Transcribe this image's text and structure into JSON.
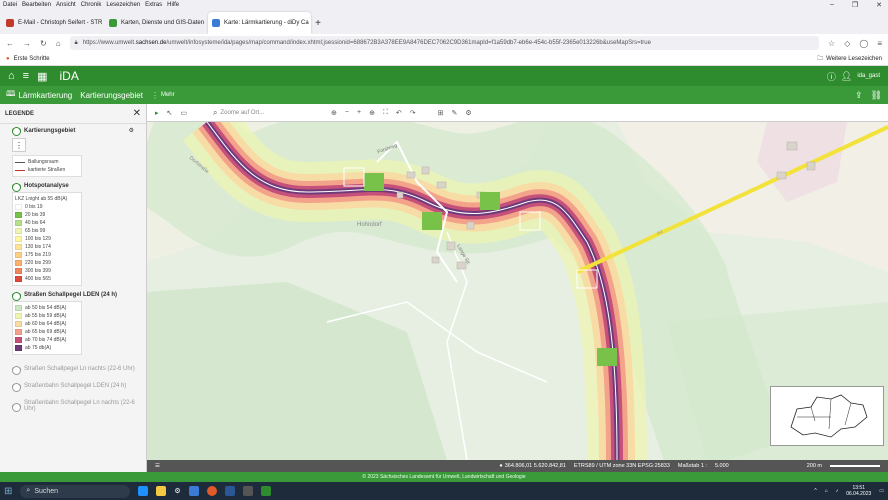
{
  "menu": [
    "Datei",
    "Bearbeiten",
    "Ansicht",
    "Chronik",
    "Lesezeichen",
    "Extras",
    "Hilfe"
  ],
  "window_controls": [
    "–",
    "❐",
    "✕"
  ],
  "tabs": [
    {
      "label": "E-Mail - Christoph Seifert - STR",
      "color": "#c0392b",
      "active": false
    },
    {
      "label": "Karten, Dienste und GIS-Daten",
      "color": "#3a9a3a",
      "active": false
    },
    {
      "label": "Karte: Lärmkartierung - diDy Ca",
      "color": "#3a7bd5",
      "active": true
    }
  ],
  "newtab": "+",
  "url": {
    "prefix": "https://www.umwelt.",
    "domain": "sachsen.de",
    "suffix": "/umwelt/infosysteme/ida/pages/map/command/index.xhtml;jsessionid=688672B3A378EE9A8476DEC7062C9D361mapId=f1a59db7-eb6e-454c-b55f-2365e013226b&useMapSrs=true"
  },
  "bookmarks": {
    "left": "Erste Schritte",
    "right": "Weitere Lesezeichen"
  },
  "app": {
    "brand": "iDA",
    "user": "ida_gast"
  },
  "themes": {
    "t1": "Lärmkartierung",
    "t2": "Kartierungsgebiet",
    "more": "Mehr"
  },
  "legend": {
    "title": "LEGENDE",
    "close": "✕",
    "groups": {
      "kartierungsgebiet": {
        "label": "Kartierungsgebiet",
        "items": [
          {
            "label": "Ballungsraum",
            "color": "#555555"
          },
          {
            "label": "kartierte Straßen",
            "color": "#c0392b"
          }
        ]
      },
      "hotspot": {
        "label": "Hotspotanalyse",
        "header": "LKZ Lnight ab 55 dB(A)",
        "items": [
          {
            "label": "0 bis 19",
            "color": "#ffffff"
          },
          {
            "label": "20 bis 39",
            "color": "#78c24a"
          },
          {
            "label": "40 bis 64",
            "color": "#b8e08a"
          },
          {
            "label": "65 bis 99",
            "color": "#eef5b0"
          },
          {
            "label": "100 bis 129",
            "color": "#fff7a0"
          },
          {
            "label": "130 bis 174",
            "color": "#ffe39a"
          },
          {
            "label": "175 bis 219",
            "color": "#ffcf86"
          },
          {
            "label": "220 bis 299",
            "color": "#fbb06e"
          },
          {
            "label": "300 bis 399",
            "color": "#f1855c"
          },
          {
            "label": "400 bis 565",
            "color": "#e04a3c"
          }
        ]
      },
      "lden": {
        "label": "Straßen Schallpegel LDEN (24 h)",
        "items": [
          {
            "label": "ab 50 bis 54 dB(A)",
            "color": "#c9e6c0"
          },
          {
            "label": "ab 55 bis 59 dB(A)",
            "color": "#eef5b0"
          },
          {
            "label": "ab 60 bis 64 dB(A)",
            "color": "#f8dca6"
          },
          {
            "label": "ab 65 bis 69 dB(A)",
            "color": "#f3a38a"
          },
          {
            "label": "ab 70 bis 74 dB(A)",
            "color": "#c5507a"
          },
          {
            "label": "ab 75 db(A)",
            "color": "#6e3a7a"
          }
        ]
      },
      "ln": {
        "label": "Straßen Schallpegel Ln nachts (22-6 Uhr)"
      },
      "rail_lden": {
        "label": "Straßenbahn Schallpegel LDEN (24 h)"
      },
      "rail_ln": {
        "label": "Straßenbahn Schallpegel Ln nachts (22-6 Uhr)"
      }
    }
  },
  "toolbar": {
    "search_placeholder": "Zoome auf Ort..."
  },
  "map_labels": [
    "Hohndorf",
    "Hohndorf",
    "Forstweg",
    "Lange Str.",
    "A4",
    "Dorfstraße"
  ],
  "status": {
    "coords": "364.806,01  5.620.842,81",
    "crs": "ETRS89 / UTM zone 33N EPSG:25833",
    "scale_label": "Maßstab 1 :",
    "scale_value": "5.000",
    "scalebar": "200 m"
  },
  "copyright": "© 2023 Sächsisches Landesamt für Umwelt, Landwirtschaft und Geologie",
  "taskbar": {
    "search": "Suchen",
    "time": "13:51",
    "date": "06.04.2023"
  },
  "colors": {
    "green_dark": "#2e8b2e",
    "green": "#3a9a3a"
  }
}
